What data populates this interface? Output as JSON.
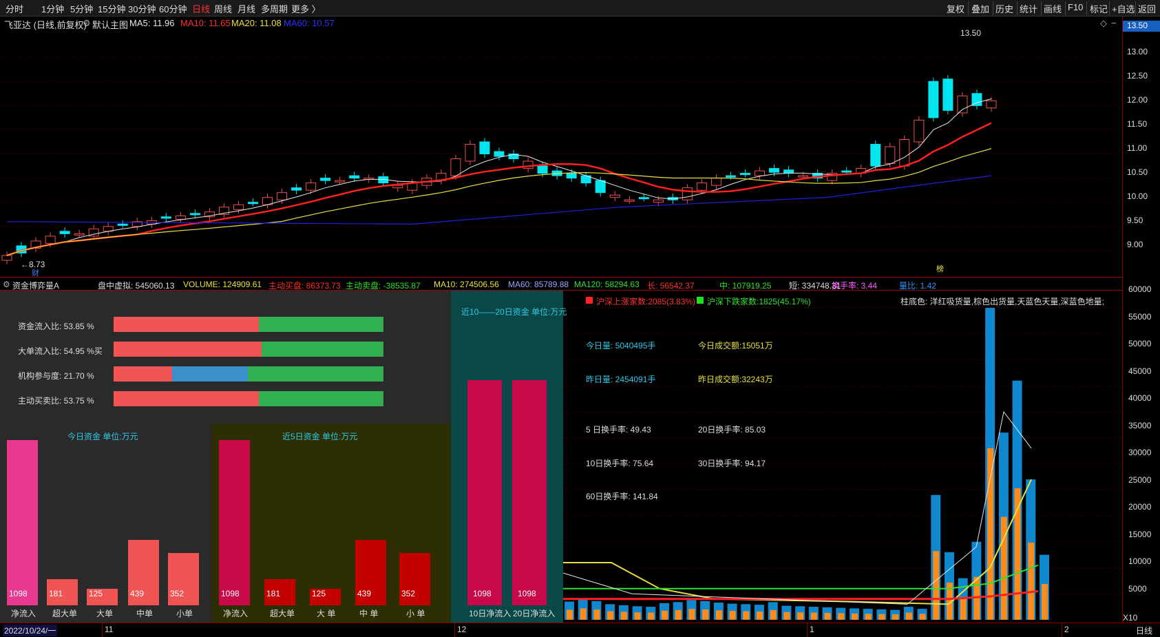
{
  "periods": [
    "分时",
    "1分钟",
    "5分钟",
    "15分钟",
    "30分钟",
    "60分钟",
    "日线",
    "周线",
    "月线",
    "多周期",
    "更多 〉"
  ],
  "active_period": "日线",
  "right_buttons": [
    "复权",
    "叠加",
    "历史",
    "统计",
    "画线",
    "F10",
    "标记",
    "+自选",
    "返回"
  ],
  "kline": {
    "title": "飞亚达 (日线,前复权)",
    "main_label": "默认主图",
    "ma5": "MA5: 11.96",
    "ma10": "MA10: 11.65",
    "ma20": "MA20: 11.08",
    "ma60": "MA60: 10.57",
    "high_label": "13.50",
    "low_label": "←8.73",
    "cai": "财",
    "bang": "榜",
    "diamond": "◇",
    "minus": "−",
    "price_ticks": [
      "13.00",
      "12.50",
      "12.00",
      "11.50",
      "11.00",
      "10.50",
      "10.00",
      "9.50",
      "9.00"
    ],
    "price_tag": "13.50",
    "colors": {
      "up": "#f05050",
      "down": "#00e5f0",
      "ma5": "#e8e8e8",
      "ma10": "#ff2020",
      "ma20": "#e8e040",
      "ma60": "#2020e0"
    }
  },
  "mid": {
    "name": "资金博弈量A",
    "pz": "盘中虚拟: 545060.13",
    "volume": "VOLUME: 124909.61",
    "buy": "主动买盘: 86373.73",
    "sell": "主动卖盘: -38535.87",
    "ma10": "MA10: 274506.56",
    "ma60": "MA60: 85789.88",
    "ma120": "MA120: 58294.63",
    "long": "长: 56542.37",
    "mid": "中: 107919.25",
    "short": "短: 334748.31",
    "turnover": "换手率: 3.44",
    "ratio": "量比: 1.42"
  },
  "ratios": [
    {
      "label": "资金流入比: 53.85 %",
      "red": 0.5385
    },
    {
      "label": "大单流入比: 54.95 %买",
      "red": 0.5495
    },
    {
      "label": "机构参与度: 21.70 %",
      "red": 0.217,
      "blue": 0.28
    },
    {
      "label": "主动买卖比: 53.75 %",
      "red": 0.5375
    }
  ],
  "today": {
    "title": "今日资金  单位:万元",
    "bars": [
      {
        "v": "1098",
        "n": "净流入"
      },
      {
        "v": "181",
        "n": "超大单"
      },
      {
        "v": "125",
        "n": "大单"
      },
      {
        "v": "439",
        "n": "中单"
      },
      {
        "v": "352",
        "n": "小单"
      }
    ]
  },
  "five": {
    "title": "近5日资金  单位:万元",
    "bars": [
      {
        "v": "1098",
        "n": "净流入"
      },
      {
        "v": "181",
        "n": "超大单"
      },
      {
        "v": "125",
        "n": "大  单"
      },
      {
        "v": "439",
        "n": "中  单"
      },
      {
        "v": "352",
        "n": "小  单"
      }
    ]
  },
  "ten": {
    "title": "近10——20日资金  单位:万元",
    "bars": [
      {
        "v": "1098",
        "n": "10日净流入"
      },
      {
        "v": "1098",
        "n": "20日净流入"
      }
    ]
  },
  "stats": {
    "up_count": "沪深上涨家数:2085(3.83%)",
    "down_count": "沪深下跌家数:1825(45.17%)",
    "legend": "柱底色: 洋红吸货量,棕色出货量,天蓝色天量,深蓝色地量;",
    "today_vol": "今日量: 5040495手",
    "today_amt": "今日成交额:15051万",
    "yest_vol": "昨日量: 2454091手",
    "yest_amt": "昨日成交额:32243万",
    "t5": "5 日换手率:  49.43",
    "t20": "20日换手率:  85.03",
    "t10": "10日换手率:  75.64",
    "t30": "30日换手率:  94.17",
    "t60": "60日换手率:  141.84"
  },
  "volume_ticks": [
    "60000",
    "55000",
    "50000",
    "45000",
    "40000",
    "35000",
    "30000",
    "25000",
    "20000",
    "15000",
    "10000",
    "5000"
  ],
  "x10": "X10",
  "bottom": {
    "date": "2022/10/24/一",
    "m11": "11",
    "m12": "12",
    "m1": "1",
    "m2": "2",
    "period": "日线"
  }
}
